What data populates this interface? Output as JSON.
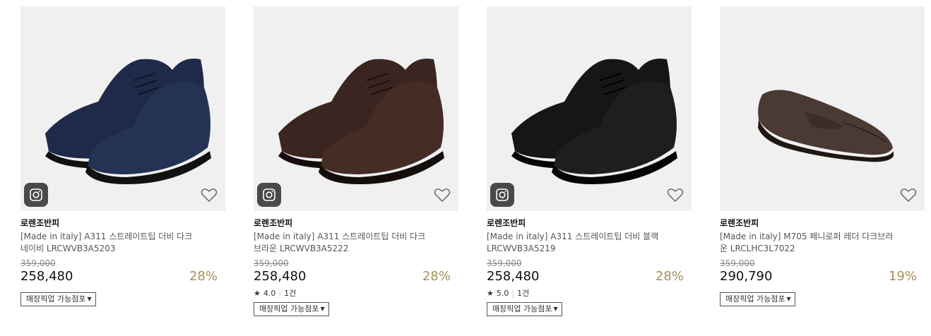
{
  "products": [
    {
      "brand": "로렌조반피",
      "name_line1": "[Made in italy] A311 스트레이트팁 더비 다크",
      "name_line2": "네이비 LRCWVB3A5203",
      "original_price": "359,000",
      "price": "258,480",
      "discount": "28%",
      "rating": null,
      "review_count": null,
      "pickup_label": "매장픽업 가능점포",
      "shoe_color": "#1f2a4a",
      "style": "derby"
    },
    {
      "brand": "로렌조반피",
      "name_line1": "[Made in italy] A311 스트레이트팁 더비 다크",
      "name_line2": "브라운 LRCWVB3A5222",
      "original_price": "359,000",
      "price": "258,480",
      "discount": "28%",
      "rating": "4.0",
      "review_count": "1건",
      "pickup_label": "매장픽업 가능점포",
      "shoe_color": "#3a2520",
      "style": "derby"
    },
    {
      "brand": "로렌조반피",
      "name_line1": "[Made in italy] A311 스트레이트팁 더비 블랙",
      "name_line2": "LRCWVB3A5219",
      "original_price": "359,000",
      "price": "258,480",
      "discount": "28%",
      "rating": "5.0",
      "review_count": "1건",
      "pickup_label": "매장픽업 가능점포",
      "shoe_color": "#111111",
      "style": "derby"
    },
    {
      "brand": "로렌조반피",
      "name_line1": "[Made in italy] M705 페니로퍼 레더 다크브라",
      "name_line2": "운 LRCLHC3L7022",
      "original_price": "359,000",
      "price": "290,790",
      "discount": "19%",
      "rating": null,
      "review_count": null,
      "pickup_label": "매장픽업 가능점포",
      "shoe_color": "#4a3a33",
      "style": "loafer"
    }
  ],
  "rating_star": "★",
  "accent_discount_color": "#a38f5c"
}
